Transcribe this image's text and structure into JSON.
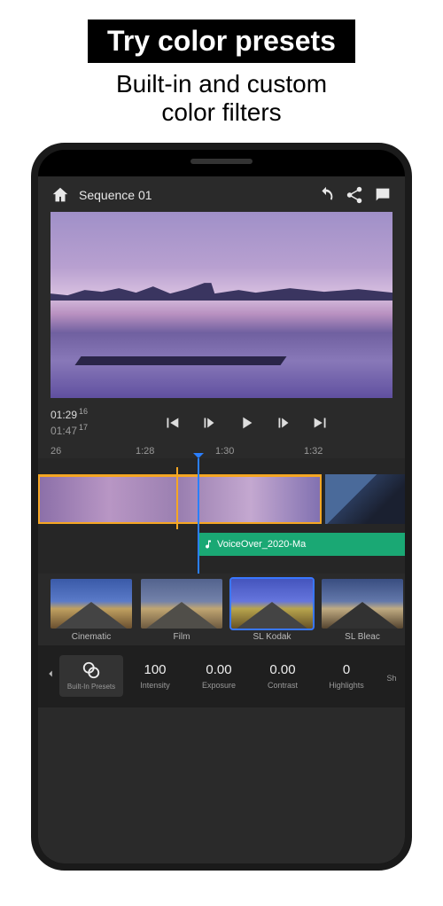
{
  "promo": {
    "title": "Try color presets",
    "subtitle_line1": "Built-in and custom",
    "subtitle_line2": "color filters"
  },
  "header": {
    "sequence_name": "Sequence 01"
  },
  "transport": {
    "clip_time": "01:29",
    "clip_frames": "16",
    "seq_time": "01:47",
    "seq_frames": "17"
  },
  "ruler": {
    "t0": "26",
    "t1": "1:28",
    "t2": "1:30",
    "t3": "1:32"
  },
  "audio": {
    "clip_name": "VoiceOver_2020-Ma"
  },
  "presets": [
    {
      "label": "Cinematic"
    },
    {
      "label": "Film"
    },
    {
      "label": "SL Kodak"
    },
    {
      "label": "SL Bleac"
    }
  ],
  "params": {
    "active_label": "Built-In Presets",
    "cells": [
      {
        "value": "100",
        "label": "Intensity"
      },
      {
        "value": "0.00",
        "label": "Exposure"
      },
      {
        "value": "0.00",
        "label": "Contrast"
      },
      {
        "value": "0",
        "label": "Highlights"
      },
      {
        "value": "",
        "label": "Sh"
      }
    ]
  },
  "colors": {
    "accent_orange": "#f5a623",
    "accent_blue": "#2a7fff",
    "audio_green": "#1aa874"
  }
}
